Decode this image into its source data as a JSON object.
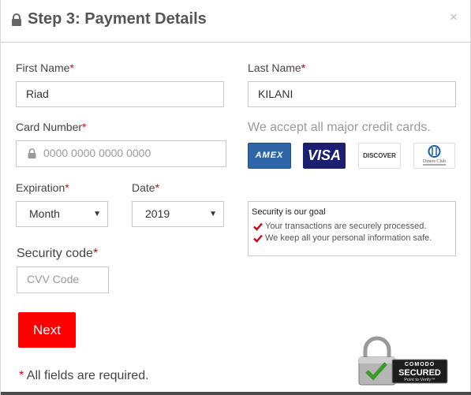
{
  "header": {
    "title": "Step 3: Payment Details",
    "close": "×"
  },
  "form": {
    "first_name": {
      "label": "First Name",
      "required": "*",
      "value": "Riad"
    },
    "last_name": {
      "label": "Last Name",
      "required": "*",
      "value": "KILANI"
    },
    "card_number": {
      "label": "Card Number",
      "required": "*",
      "placeholder": "0000 0000 0000 0000"
    },
    "expiration": {
      "label": "Expiration",
      "required": "*",
      "value": "Month"
    },
    "date": {
      "label": "Date",
      "required": "*",
      "value": "2019"
    },
    "security_code": {
      "label": "Security code",
      "required": "*",
      "placeholder": "CVV Code"
    },
    "next_button": "Next",
    "required_note": {
      "star": "*",
      "text": " All fields are required."
    }
  },
  "cards": {
    "accept_text": "We accept all major credit cards.",
    "logos": [
      {
        "name": "amex",
        "text": "AMEX",
        "color": "#2f66a8"
      },
      {
        "name": "visa",
        "text": "VISA",
        "color": "#1a1f71"
      },
      {
        "name": "discover",
        "text": "DISCOVER",
        "color": "#f07b22"
      },
      {
        "name": "diners-club",
        "text": "Diners Club"
      }
    ]
  },
  "security": {
    "title": "Security is our goal",
    "lines": [
      "Your transactions are securely processed.",
      "We keep all your personal information safe."
    ]
  },
  "badge": {
    "brand": "COMODO",
    "secured": "SECURED",
    "tagline": "Point to Verify™"
  },
  "colors": {
    "accent_red": "#ff0000",
    "required_red": "#e0001b",
    "check_red": "#d0021b",
    "footer_bar": "#4a4a4a"
  }
}
